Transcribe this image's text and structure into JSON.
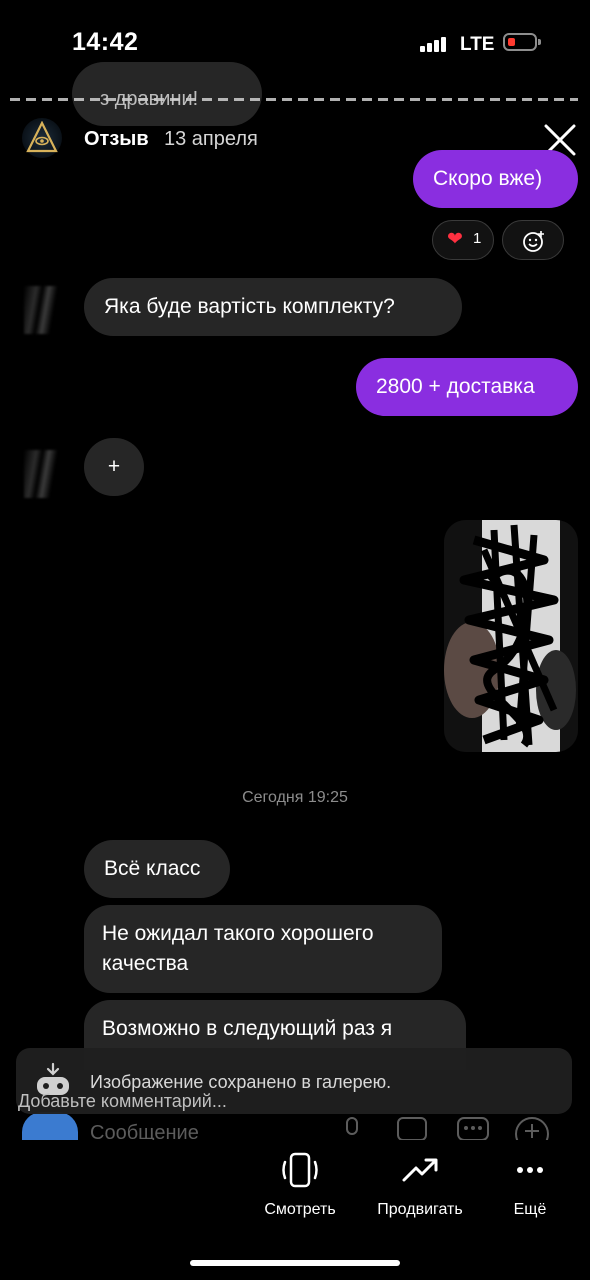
{
  "status_bar": {
    "time": "14:42",
    "network": "LTE",
    "battery_color": "#ff3b30"
  },
  "story": {
    "header": {
      "name": "Отзыв",
      "date": "13 апреля"
    },
    "cut_text": "з дравини!",
    "messages": [
      {
        "side": "mine",
        "text": "Скоро вже)"
      },
      {
        "side": "theirs",
        "text": "Яка буде  вартість комплекту?"
      },
      {
        "side": "mine",
        "text": "2800 + доставка"
      },
      {
        "side": "theirs",
        "text": "Всё класс"
      },
      {
        "side": "theirs",
        "line1": "Не ожидал такого хорошего",
        "line2": "качества"
      },
      {
        "side": "theirs",
        "text": "Возможно в следующий раз я"
      }
    ],
    "reactions": {
      "heart_count": "1",
      "plus_label": "+"
    },
    "timestamp": "Сегодня 19:25",
    "input_placeholder": "Сообщение"
  },
  "toast": {
    "text": "Изображение сохранено в галерею."
  },
  "comment_placeholder": "Добавьте комментарий...",
  "actions": [
    {
      "label": "Смотреть",
      "icon": "phone-rotate-icon"
    },
    {
      "label": "Продвигать",
      "icon": "trending-up-icon"
    },
    {
      "label": "Ещё",
      "icon": "more-dots-icon"
    }
  ],
  "colors": {
    "accent": "#8a2ee0",
    "bubble_theirs": "#262626",
    "background": "#000000"
  }
}
